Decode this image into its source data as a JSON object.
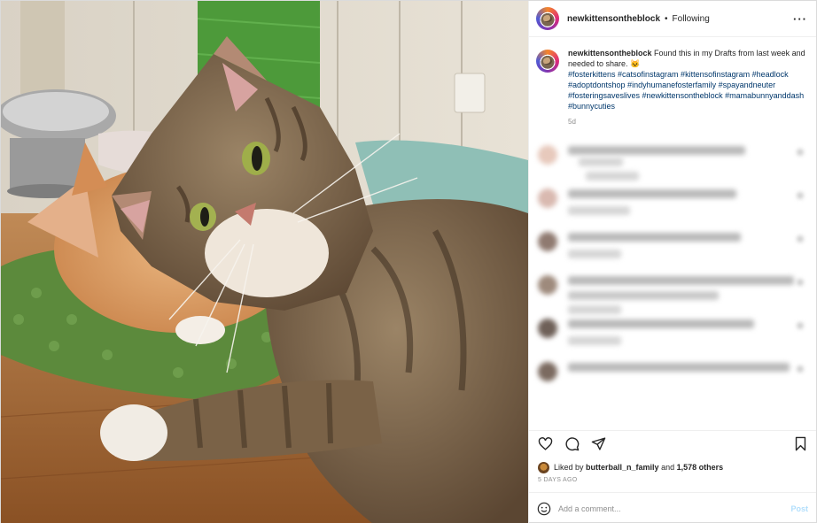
{
  "post": {
    "username": "newkittensontheblock",
    "separator": "•",
    "follow_status": "Following",
    "more_icon": "more-options-icon",
    "caption": {
      "username": "newkittensontheblock",
      "text": "Found this in my Drafts from last week and needed to share. 🐱",
      "hashtags": "#fosterkittens #catsofinstagram #kittensofinstagram #headlock #adoptdontshop #indyhumanefosterfamily #spayandneuter #fosteringsaveslives #newkittensontheblock #mamabunnyanddash #bunnycuties",
      "time": "5d"
    },
    "actions": {
      "like_icon": "heart-icon",
      "comment_icon": "comment-icon",
      "share_icon": "share-icon",
      "save_icon": "bookmark-icon"
    },
    "likes": {
      "prefix": "Liked by",
      "user": "butterball_n_family",
      "joiner": "and",
      "others": "1,578 others"
    },
    "date": "5 DAYS AGO",
    "add_comment": {
      "placeholder": "Add a comment...",
      "post_label": "Post",
      "emoji_icon": "emoji-icon"
    },
    "colors": {
      "link": "#00376b",
      "muted": "#8e8e8e",
      "post_disabled": "#b2dffc"
    }
  }
}
